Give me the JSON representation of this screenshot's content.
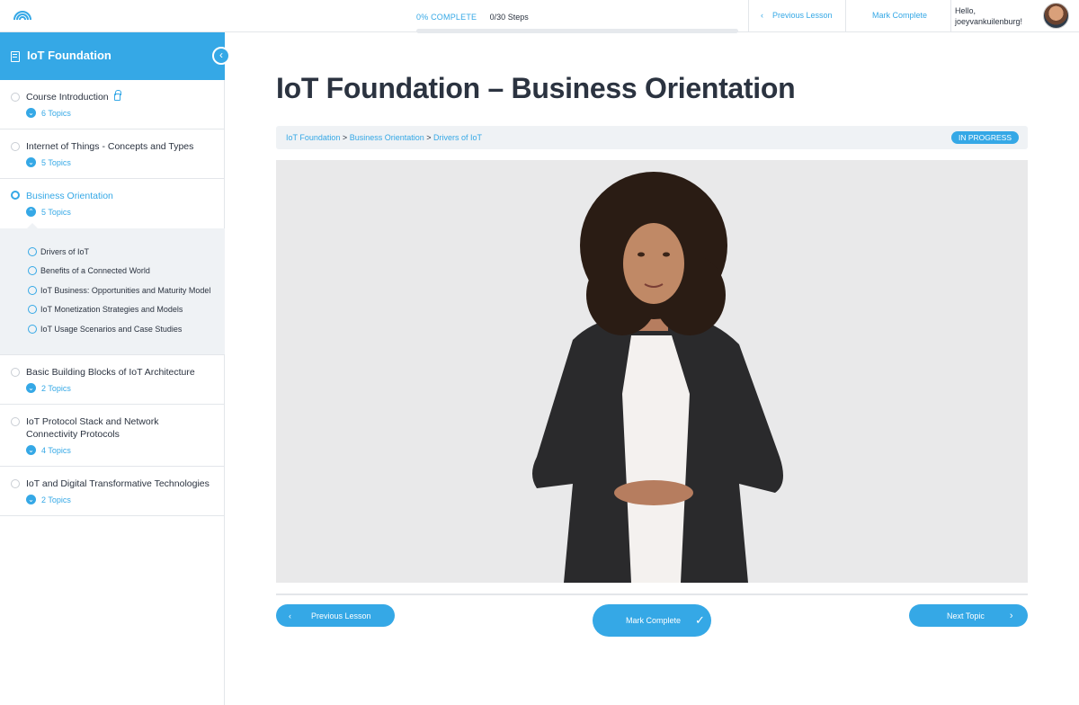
{
  "header": {
    "progress_percent_label": "0% COMPLETE",
    "progress_fraction": 0,
    "steps_label": "0/30 Steps",
    "prev_lesson_label": "Previous Lesson",
    "mark_complete_label": "Mark Complete",
    "greeting_line1": "Hello,",
    "greeting_line2": "joeyvankuilenburg!"
  },
  "sidebar": {
    "course_title": "IoT Foundation",
    "lessons": [
      {
        "title": "Course Introduction",
        "topics": "6 Topics",
        "locked": true,
        "active": false
      },
      {
        "title": "Internet of Things - Concepts and Types",
        "topics": "5 Topics",
        "active": false
      },
      {
        "title": "Business Orientation",
        "topics": "5 Topics",
        "active": true
      },
      {
        "title": "Basic Building Blocks of IoT Architecture",
        "topics": "2 Topics",
        "active": false
      },
      {
        "title": "IoT Protocol Stack and Network Connectivity Protocols",
        "topics": "4 Topics",
        "active": false
      },
      {
        "title": "IoT and Digital Transformative Technologies",
        "topics": "2 Topics",
        "active": false
      }
    ],
    "active_topics": [
      "Drivers of IoT",
      "Benefits of a Connected World",
      "IoT Business: Opportunities and Maturity Model",
      "IoT Monetization Strategies and Models",
      "IoT Usage Scenarios and Case Studies"
    ]
  },
  "main": {
    "title": "IoT Foundation – Business Orientation",
    "breadcrumb": [
      "IoT Foundation",
      "Business Orientation",
      "Drivers of IoT"
    ],
    "breadcrumb_sep": ">",
    "status": "IN PROGRESS",
    "prev_button": "Previous Lesson",
    "mark_button": "Mark Complete",
    "next_button": "Next Topic"
  },
  "colors": {
    "accent": "#35a8e6",
    "text": "#2b3340",
    "panel": "#eff2f5"
  }
}
